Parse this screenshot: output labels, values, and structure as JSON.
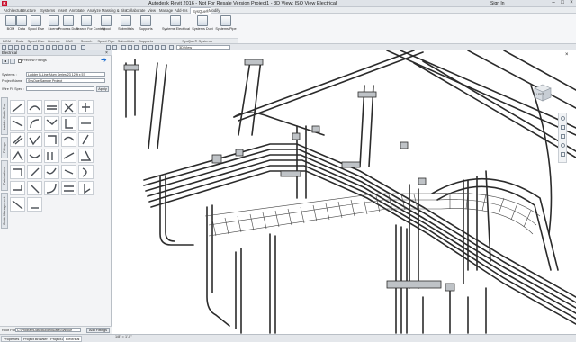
{
  "window": {
    "title": "Autodesk Revit 2016 - Not For Resale Version    Project1 - 3D View: ISO View Electrical",
    "sign_in": "Sign In"
  },
  "menu": {
    "items": [
      "Architecture",
      "Structure",
      "Systems",
      "Insert",
      "Annotate",
      "Analyze",
      "Massing & Site",
      "Collaborate",
      "View",
      "Manage",
      "Add-Ins",
      "SysQue®",
      "Modify"
    ],
    "active": "SysQue®"
  },
  "ribbon": {
    "buttons": [
      "BOM",
      "Data",
      "Spool Else",
      "License",
      "Process Duct",
      "Search For Content",
      "Spool",
      "Submittals",
      "Supports",
      "Systems Electrical",
      "Systems Duct",
      "Systems Pipe"
    ],
    "panels": [
      "BOM",
      "Data",
      "Spool Else",
      "License",
      "FAC",
      "Search",
      "Spool Pipe",
      "Submittals",
      "Supports",
      "SysQue® Systems"
    ]
  },
  "view_selector": "3D View",
  "left_panel": {
    "header": "Electrical",
    "preview_fittings": "Preview Fittings",
    "systems_label": "Systems :",
    "systems_value": "Ladder B-Line Alum Series 23 12 ft x 57",
    "project_label": "Project Name",
    "project_value": "SysQue Sample Project",
    "wire_label": "Wire Fit Spec :",
    "apply": "Apply",
    "tabs": [
      "Ladder Cable Tray",
      "Fittings",
      "Fabrications",
      "Cable Management"
    ],
    "path_label": "Root Path",
    "path_value": "C:\\ProgramData\\BuildingData\\SysQue",
    "add_fittings": "Add Fittings"
  },
  "status": {
    "tabs": [
      "Properties",
      "Project Browser - Project1",
      "Electrical"
    ],
    "active_tab": "Electrical",
    "scale": "1/8\" = 1'-0\""
  },
  "viewcube": {
    "face": "LEFT"
  },
  "colors": {
    "ribbon_bg": "#f5f6f8",
    "titlebar_bg": "#dfe3e8",
    "model_line": "#2b2b2b"
  }
}
